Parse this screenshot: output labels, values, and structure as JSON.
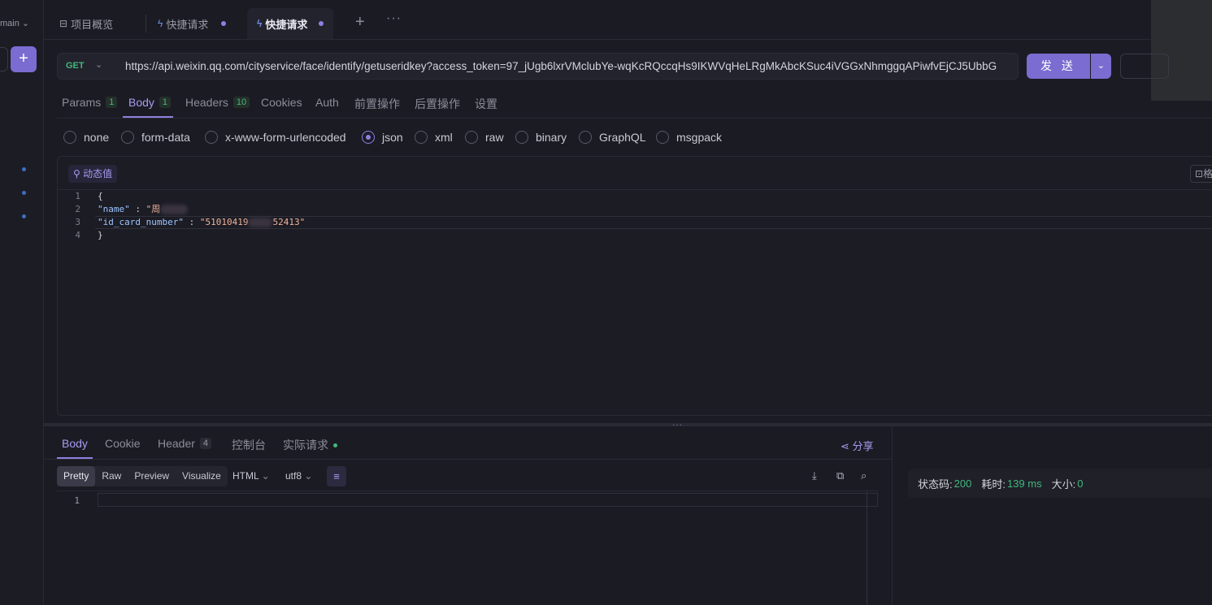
{
  "sidebar": {
    "branch": "main",
    "add_label": "+"
  },
  "tabs": [
    {
      "label": "项目概览",
      "icon": "overview-icon"
    },
    {
      "label": "快捷请求",
      "icon": "lightning-icon"
    },
    {
      "label": "快捷请求",
      "icon": "lightning-icon"
    }
  ],
  "request": {
    "method": "GET",
    "url": "https://api.weixin.qq.com/cityservice/face/identify/getuseridkey?access_token=97_jUgb6lxrVMclubYe-wqKcRQccqHs9IKWVqHeLRgMkAbcKSuc4iVGGxNhmggqAPiwfvEjCJ5UbbG",
    "send_label": "发 送"
  },
  "request_tabs": [
    {
      "label": "Params",
      "badge": "1"
    },
    {
      "label": "Body",
      "badge": "1"
    },
    {
      "label": "Headers",
      "badge": "10"
    },
    {
      "label": "Cookies"
    },
    {
      "label": "Auth"
    },
    {
      "label": "前置操作"
    },
    {
      "label": "后置操作"
    },
    {
      "label": "设置"
    }
  ],
  "body_types": [
    "none",
    "form-data",
    "x-www-form-urlencoded",
    "json",
    "xml",
    "raw",
    "binary",
    "GraphQL",
    "msgpack"
  ],
  "body_type_selected": "json",
  "editor": {
    "dynamic_label": "动态值",
    "format_label": "格",
    "lines": [
      {
        "n": "1",
        "text": "{"
      },
      {
        "n": "2",
        "key": "\"name\"",
        "sep": " : ",
        "value": "\"周"
      },
      {
        "n": "3",
        "key": "\"id_card_number\"",
        "sep": " : ",
        "value_a": "\"51010419",
        "value_b": "52413\""
      },
      {
        "n": "4",
        "text": "}"
      }
    ]
  },
  "response_tabs": [
    {
      "label": "Body"
    },
    {
      "label": "Cookie"
    },
    {
      "label": "Header",
      "badge": "4"
    },
    {
      "label": "控制台"
    },
    {
      "label": "实际请求"
    }
  ],
  "share_label": "分享",
  "response_view": {
    "options": [
      "Pretty",
      "Raw",
      "Preview",
      "Visualize"
    ],
    "selected": "Pretty",
    "language": "HTML",
    "encoding": "utf8",
    "line": "1"
  },
  "status": {
    "code_label": "状态码:",
    "code": "200",
    "time_label": "耗时:",
    "time": "139 ms",
    "size_label": "大小:",
    "size": "0"
  },
  "colors": {
    "accent": "#8f7fe0",
    "success": "#3fb97a",
    "background": "#1b1b24"
  }
}
